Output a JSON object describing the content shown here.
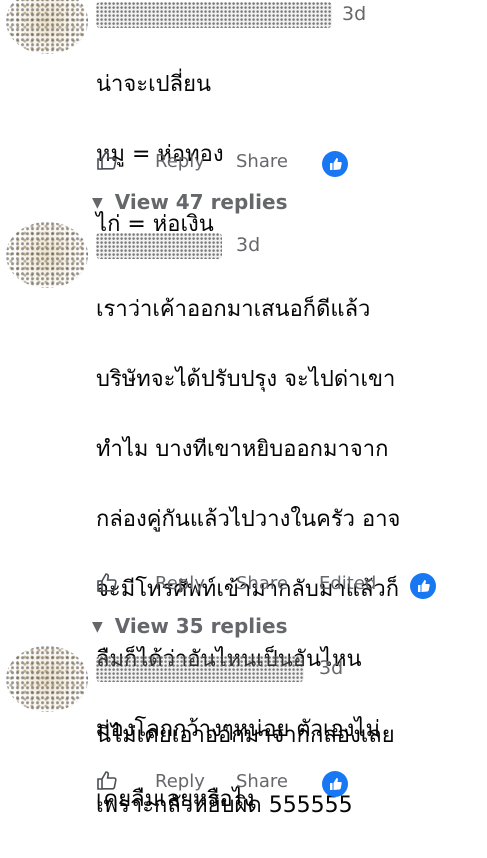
{
  "comments": [
    {
      "time": "3d",
      "lines": [
        "น่าจะเปลี่ยน",
        "หมู = ห่อทอง",
        "ไก่ = ห่อเงิน"
      ],
      "actions": {
        "reply": "Reply",
        "share": "Share"
      }
    },
    {
      "time": "3d",
      "lines": [
        "เราว่าเค้าออกมาเสนอก็ดีแล้ว",
        "บริษัทจะได้ปรับปรุง จะไปด่าเขา",
        "ทำไม บางทีเขาหยิบออกมาจาก",
        "กล่องคู่กันแล้วไปวางในครัว อาจ",
        "จะมีโทรศัพท์เข้ามากลับมาแล้วก็",
        "ลืมก็ได้ว่าอันไหนเป็นอันไหน",
        "มองโลกกว้างๆหน่อย ตัวเองไม่",
        "เคยลืมเลยหรือไง"
      ],
      "actions": {
        "reply": "Reply",
        "share": "Share",
        "edited": "Edited"
      }
    },
    {
      "time": "3d",
      "lines": [
        "นี่ไม่เคยเอาออกมาจากกล่องเลย",
        "เพราะกลัวหยิบผิด 555555"
      ],
      "actions": {
        "reply": "Reply",
        "share": "Share"
      }
    }
  ],
  "view_replies": [
    "View 47 replies",
    "View 35 replies"
  ],
  "colors": {
    "reaction": "#1877f2",
    "secondary_text": "#65676b"
  },
  "icons": {
    "like": "thumbs-up-outline-icon",
    "reaction": "like-reaction-icon",
    "expand": "chevron-down-icon"
  }
}
